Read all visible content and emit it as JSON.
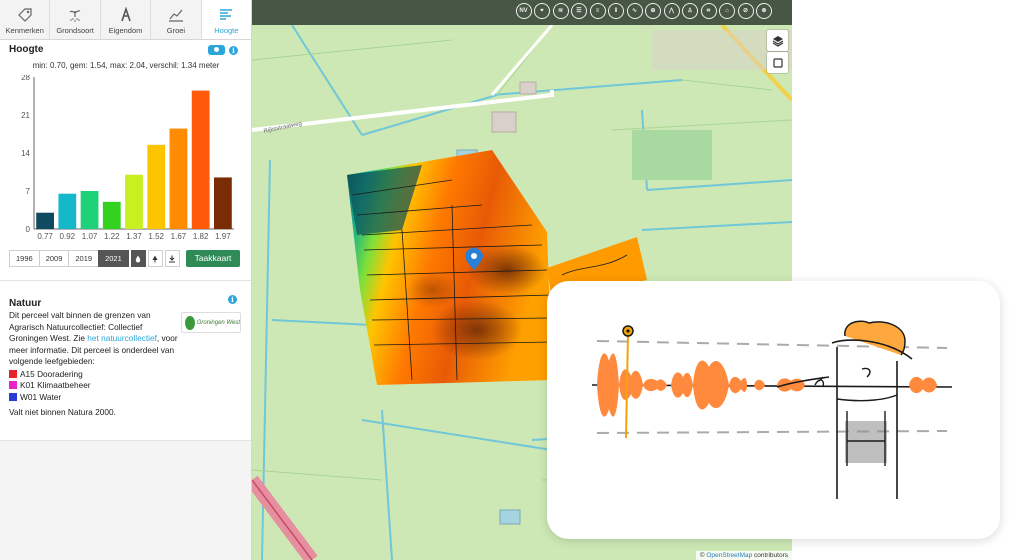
{
  "tabs": [
    {
      "label": "Kenmerken",
      "icon": "tag-icon"
    },
    {
      "label": "Grondsoort",
      "icon": "plant-icon"
    },
    {
      "label": "Eigendom",
      "icon": "ownership-icon"
    },
    {
      "label": "Groei",
      "icon": "growth-chart-icon"
    },
    {
      "label": "Hoogte",
      "icon": "height-lines-icon",
      "active": true
    }
  ],
  "hoogte": {
    "title": "Hoogte",
    "stats": "min: 0.70, gem: 1.54, max: 2.04, verschil: 1.34 meter"
  },
  "chart_data": {
    "type": "bar",
    "categories": [
      "0.77",
      "0.92",
      "1.07",
      "1.22",
      "1.37",
      "1.52",
      "1.67",
      "1.82",
      "1.97"
    ],
    "values": [
      3,
      6.5,
      7,
      5,
      10,
      15.5,
      18.5,
      25.5,
      9.5
    ],
    "colors": [
      "#0f4a5e",
      "#14b8c8",
      "#1fd27a",
      "#33d21f",
      "#c8f020",
      "#ffc400",
      "#ff8c00",
      "#ff5a0a",
      "#7a2c05"
    ],
    "ylabel_ticks": [
      0,
      7,
      14,
      21,
      28
    ],
    "ylim": [
      0,
      28
    ],
    "xlabel": "",
    "ylabel": "",
    "grid": false
  },
  "years": [
    {
      "label": "1996",
      "active": false
    },
    {
      "label": "2009",
      "active": false
    },
    {
      "label": "2019",
      "active": false
    },
    {
      "label": "2021",
      "active": true
    }
  ],
  "taakkaart_label": "Taakkaart",
  "natuur": {
    "title": "Natuur",
    "text_before": "Dit perceel valt binnen de grenzen van Agrarisch Natuurcollectief: Collectief Groningen West. Zie ",
    "link": "het natuurcollectief",
    "text_after": ", voor meer informatie. Dit perceel is onderdeel van volgende leefgebieden:",
    "logo_text": "Groningen West",
    "leefgebieden": [
      {
        "label": "A15 Dooradering",
        "color": "#e8222a"
      },
      {
        "label": "K01 Klimaatbeheer",
        "color": "#e822c8"
      },
      {
        "label": "W01 Water",
        "color": "#2a3ad8"
      }
    ],
    "natura": "Valt niet binnen Natura 2000."
  },
  "map": {
    "road_label": "Rijksstraatweg",
    "tools": [
      "NV",
      "pin",
      "layers",
      "lines",
      "list",
      "bars",
      "wave",
      "zoom",
      "slope",
      "person",
      "crop",
      "building",
      "no-drop",
      "no-edit"
    ],
    "attribution_prefix": "©",
    "attribution_link": "OpenStreetMap",
    "attribution_suffix": " contributors"
  }
}
